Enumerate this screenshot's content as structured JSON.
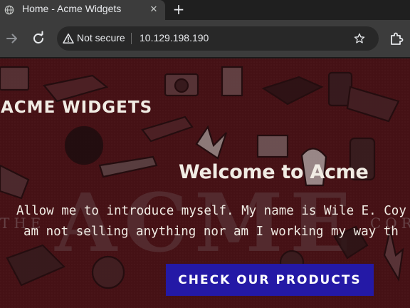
{
  "browser": {
    "tab": {
      "title": "Home - Acme Widgets",
      "close_glyph": "✕",
      "favicon": "globe-icon"
    },
    "new_tab_glyph": "+",
    "toolbar": {
      "security_label": "Not secure",
      "url": "10.129.198.190",
      "icons": [
        "forward-arrow-icon",
        "reload-icon",
        "warning-triangle-icon",
        "bookmark-star-icon",
        "extensions-puzzle-icon"
      ]
    }
  },
  "page": {
    "brand": "ACME WIDGETS",
    "hero": {
      "title": "Welcome to Acme",
      "line1": "Allow me to introduce myself. My name is Wile E. Coy",
      "line2": "am not selling anything nor am I working my way th",
      "cta_label": "CHECK OUR PRODUCTS"
    },
    "background": {
      "lettering": "ACME",
      "side_left": "THE",
      "side_right": "CORP"
    }
  },
  "colors": {
    "hero_red": "#4a1418",
    "button_blue": "#2419a6",
    "text_cream": "#f1ece4",
    "chrome_dark": "#3c3c3c"
  }
}
